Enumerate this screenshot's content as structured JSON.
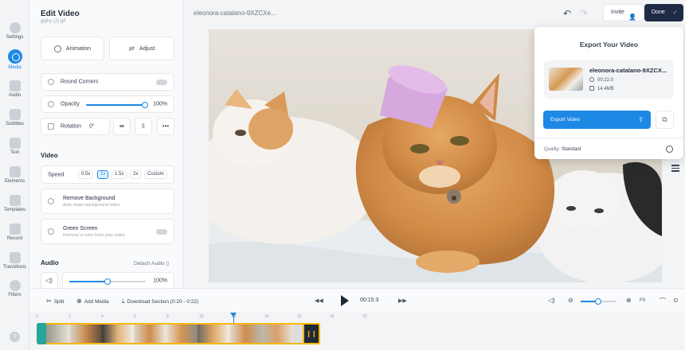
{
  "nav": {
    "items": [
      {
        "label": "Settings",
        "icon": "gear-icon"
      },
      {
        "label": "Media",
        "icon": "media-icon",
        "active": true
      },
      {
        "label": "Audio",
        "icon": "audio-icon"
      },
      {
        "label": "Subtitles",
        "icon": "subtitles-icon"
      },
      {
        "label": "Text",
        "icon": "text-icon"
      },
      {
        "label": "Elements",
        "icon": "elements-icon"
      },
      {
        "label": "Templates",
        "icon": "templates-icon"
      },
      {
        "label": "Record",
        "icon": "record-icon"
      },
      {
        "label": "Transitions",
        "icon": "transitions-icon"
      },
      {
        "label": "Filters",
        "icon": "filters-icon"
      }
    ],
    "help": "?"
  },
  "panel": {
    "title": "Edit Video",
    "subtitle": "giphy (2).gif",
    "animation_label": "Animation",
    "adjust_label": "Adjust",
    "round_corners_label": "Round Corners",
    "opacity_label": "Opacity",
    "opacity_value": "100%",
    "opacity_level": 1.0,
    "rotation_label": "Rotation",
    "rotation_value": "0°",
    "more_label": "•••",
    "video_section": "Video",
    "speed_label": "Speed",
    "speed_options": [
      "0.5x",
      "1x",
      "1.5x",
      "2x",
      "Custom"
    ],
    "speed_selected": "1x",
    "remove_bg_title": "Remove Background",
    "remove_bg_desc": "Auto erase background video",
    "green_screen_title": "Green Screen",
    "green_screen_desc": "Remove a color from your video",
    "audio_section": "Audio",
    "detach_audio": "Detach Audio",
    "volume_value": "100%",
    "volume_level": 0.5
  },
  "topbar": {
    "filename": "eleonora-catalano-9XZCXe...",
    "invite_label": "Invite",
    "done_label": "Done"
  },
  "export": {
    "title": "Export Your Video",
    "file_name": "eleonora-catalano-9XZCX...",
    "duration": "00:22.0",
    "size": "14.4MB",
    "button_label": "Export Video",
    "quality_label": "Quality:",
    "quality_value": "Standard"
  },
  "timeline": {
    "split_label": "Split",
    "add_media_label": "Add Media",
    "download_section_label": "Download Section (0:20 - 0:22)",
    "time": "00:15:3",
    "fit_label": "Fit",
    "zoom_level": 0.5,
    "ruler_ticks": [
      "0",
      "2",
      "4",
      "6",
      "8",
      "10",
      "12",
      "14",
      "16",
      "18",
      "20"
    ]
  },
  "colors": {
    "accent": "#1e88e5",
    "done_bg": "#1f2a44",
    "track_border": "#f5b800"
  }
}
